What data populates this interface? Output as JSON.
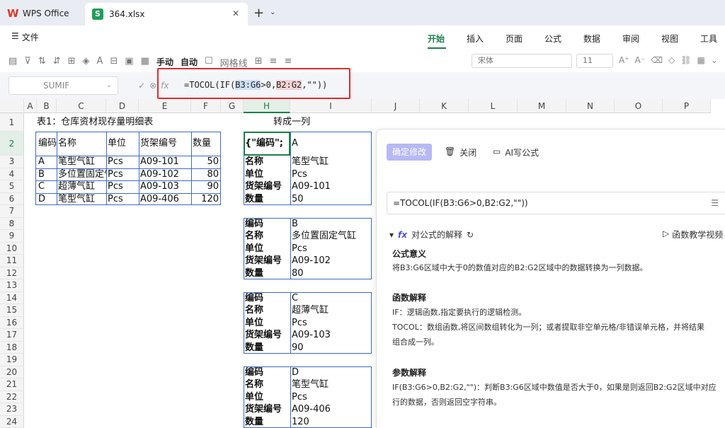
{
  "titlebar": {
    "app_tab": "WPS Office",
    "file_tab": "364.xlsx",
    "file_icon": "S"
  },
  "menubar": {
    "file_label": "文件",
    "tabs": [
      "开始",
      "插入",
      "页面",
      "公式",
      "数据",
      "审阅",
      "视图",
      "工具"
    ]
  },
  "toolbar": {
    "wrap_manual": "手动",
    "wrap_auto": "自动",
    "gridlines": "网格线",
    "font_name": "宋体",
    "font_size": "11"
  },
  "formulabar": {
    "namebox": "SUMIF",
    "formula_prefix": "=TOCOL(IF(",
    "range1": "B3:G6",
    "formula_mid": ">0,",
    "range2": "B2:G2",
    "formula_suffix": ",\"\"))"
  },
  "grid": {
    "columns": [
      "A",
      "B",
      "C",
      "D",
      "E",
      "F",
      "G",
      "H",
      "I",
      "J",
      "K",
      "L",
      "M",
      "N",
      "O",
      "P"
    ],
    "rows": [
      "1",
      "2",
      "3",
      "4",
      "5",
      "6",
      "7",
      "8",
      "9",
      "10",
      "11",
      "12",
      "13",
      "14",
      "15",
      "16",
      "17",
      "18",
      "19",
      "20",
      "21",
      "22",
      "23",
      "24"
    ],
    "table_title": "表1：仓库资材现存量明细表",
    "convert_title": "转成一列",
    "headers": [
      "编码",
      "名称",
      "单位",
      "货架编号",
      "数量"
    ],
    "rows_data": [
      [
        "A",
        "笔型气缸",
        "Pcs",
        "A09-101",
        "50"
      ],
      [
        "B",
        "多位置固定气缸",
        "Pcs",
        "A09-102",
        "80"
      ],
      [
        "C",
        "超薄气缸",
        "Pcs",
        "A09-103",
        "90"
      ],
      [
        "D",
        "笔型气缸",
        "Pcs",
        "A09-406",
        "120"
      ]
    ],
    "h2_text": "{\"编码\";",
    "h_labels": [
      "编码",
      "名称",
      "单位",
      "货架编号",
      "数量"
    ]
  },
  "panel": {
    "confirm": "确定修改",
    "close": "关闭",
    "ai_formula": "AI写公式",
    "formula": "=TOCOL(IF(B3:G6>0,B2:G2,\"\"))",
    "explain_title": "对公式的解释",
    "video": "函数教学视频",
    "sec1_title": "公式意义",
    "sec1_text": "将B3:G6区域中大于0的数值对应的B2:G2区域中的数据转换为一列数据。",
    "sec2_title": "函数解释",
    "sec2_line1": "IF：逻辑函数,指定要执行的逻辑检测。",
    "sec2_line2": "TOCOL：数组函数,将区间数组转化为一列；或者提取非空单元格/非错误单元格，并将结果",
    "sec2_line3": "组合成一列。",
    "sec3_title": "参数解释",
    "sec3_line1": "IF(B3:G6>0,B2:G2,\"\")：判断B3:G6区域中数值是否大于0，如果是则返回B2:G2区域中对应",
    "sec3_line2": "行的数据，否则返回空字符串。"
  }
}
